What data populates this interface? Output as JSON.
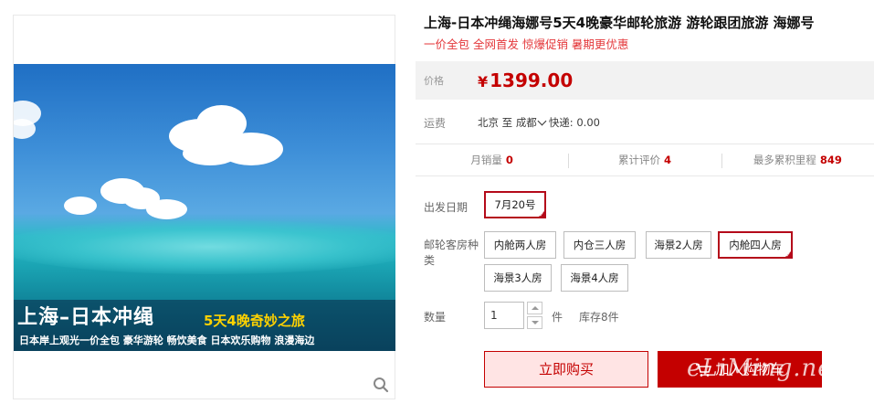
{
  "gallery": {
    "banner_title": "上海–日本冲绳",
    "banner_subtitle": "5天4晚奇妙之旅",
    "banner_features": "日本岸上观光一价全包 豪华游轮 畅饮美食 日本欢乐购物 浪漫海边",
    "zoom_icon": "magnifier-icon"
  },
  "product": {
    "title": "上海-日本冲绳海娜号5天4晚豪华邮轮旅游 游轮跟团旅游 海娜号",
    "subtitle": "一价全包 全网首发 惊爆促销 暑期更优惠",
    "price_label": "价格",
    "currency": "¥",
    "price": "1399.00",
    "shipping_label": "运费",
    "shipping_from": "北京",
    "shipping_to_word": "至",
    "shipping_to": "成都",
    "shipping_method": "快递: 0.00"
  },
  "stats": {
    "monthly_sales_label": "月销量",
    "monthly_sales": "0",
    "reviews_label": "累计评价",
    "reviews": "4",
    "points_label": "最多累积里程",
    "points": "849"
  },
  "options": {
    "date_label": "出发日期",
    "dates": [
      {
        "label": "7月20号",
        "selected": true
      }
    ],
    "room_label_line1": "邮轮客房种",
    "room_label_line2": "类",
    "rooms": [
      {
        "label": "内舱两人房",
        "selected": false
      },
      {
        "label": "内仓三人房",
        "selected": false
      },
      {
        "label": "海景2人房",
        "selected": false
      },
      {
        "label": "内舱四人房",
        "selected": true
      },
      {
        "label": "海景3人房",
        "selected": false
      },
      {
        "label": "海景4人房",
        "selected": false
      }
    ]
  },
  "quantity": {
    "label": "数量",
    "value": "1",
    "unit": "件",
    "stock": "库存8件"
  },
  "actions": {
    "buy_now": "立即购买",
    "add_to_cart": "加入购物车"
  },
  "watermark": "eLiMing.net",
  "colors": {
    "accent_red": "#c40000",
    "subtitle_red": "#e4393c",
    "selected_border": "#b40a1a"
  }
}
